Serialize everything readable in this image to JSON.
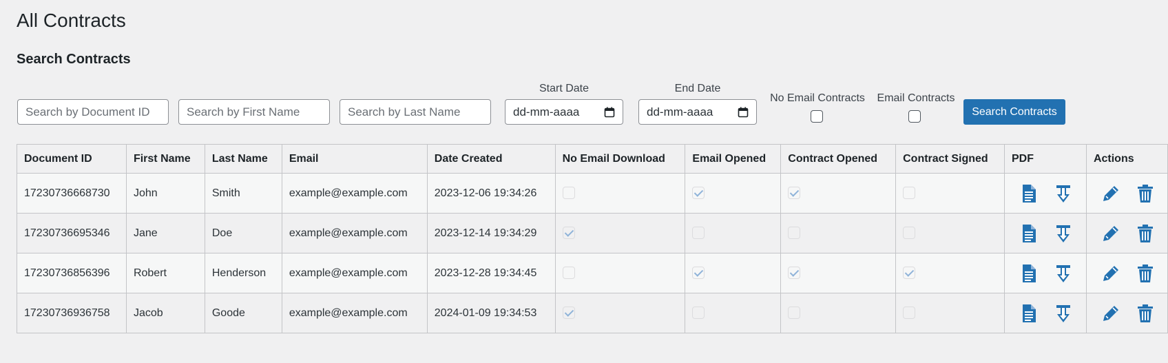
{
  "page": {
    "title": "All Contracts",
    "subtitle": "Search Contracts"
  },
  "search": {
    "doc_id_placeholder": "Search by Document ID",
    "first_name_placeholder": "Search by First Name",
    "last_name_placeholder": "Search by Last Name",
    "start_date_label": "Start Date",
    "start_date_value": "dd-mm-aaaa",
    "end_date_label": "End Date",
    "end_date_value": "dd-mm-aaaa",
    "no_email_label": "No Email Contracts",
    "email_label": "Email Contracts",
    "button_label": "Search Contracts"
  },
  "table": {
    "headers": {
      "doc_id": "Document ID",
      "first_name": "First Name",
      "last_name": "Last Name",
      "email": "Email",
      "date_created": "Date Created",
      "no_email_download": "No Email Download",
      "email_opened": "Email Opened",
      "contract_opened": "Contract Opened",
      "contract_signed": "Contract Signed",
      "pdf": "PDF",
      "actions": "Actions"
    },
    "rows": [
      {
        "doc_id": "17230736668730",
        "first_name": "John",
        "last_name": "Smith",
        "email": "example@example.com",
        "date_created": "2023-12-06 19:34:26",
        "no_email_download": false,
        "email_opened": true,
        "contract_opened": true,
        "contract_signed": false
      },
      {
        "doc_id": "17230736695346",
        "first_name": "Jane",
        "last_name": "Doe",
        "email": "example@example.com",
        "date_created": "2023-12-14 19:34:29",
        "no_email_download": true,
        "email_opened": false,
        "contract_opened": false,
        "contract_signed": false
      },
      {
        "doc_id": "17230736856396",
        "first_name": "Robert",
        "last_name": "Henderson",
        "email": "example@example.com",
        "date_created": "2023-12-28 19:34:45",
        "no_email_download": false,
        "email_opened": true,
        "contract_opened": true,
        "contract_signed": true
      },
      {
        "doc_id": "17230736936758",
        "first_name": "Jacob",
        "last_name": "Goode",
        "email": "example@example.com",
        "date_created": "2024-01-09 19:34:53",
        "no_email_download": true,
        "email_opened": false,
        "contract_opened": false,
        "contract_signed": false
      }
    ]
  },
  "icons": {
    "view_pdf": "document-icon",
    "download_pdf": "download-arrow-icon",
    "edit": "pencil-icon",
    "delete": "trash-icon"
  },
  "colors": {
    "accent": "#2271b1",
    "icon": "#2271b1",
    "check": "#8fb3d9"
  }
}
